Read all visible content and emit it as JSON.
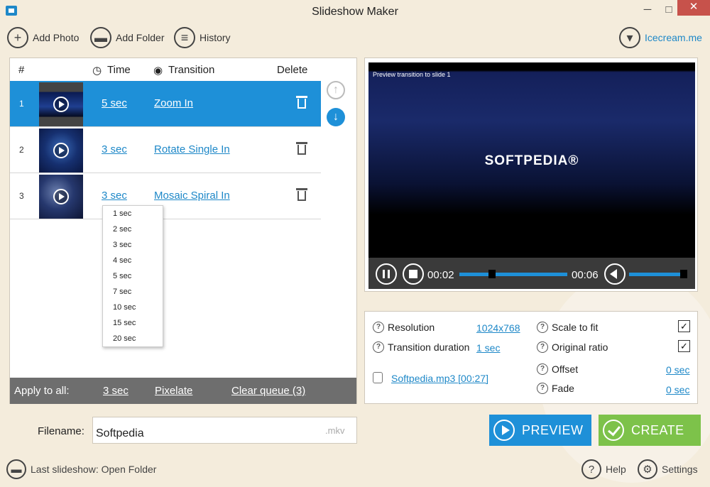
{
  "window": {
    "title": "Slideshow Maker",
    "minimize": "─",
    "maximize": "□",
    "close": "✕"
  },
  "toolbar": {
    "add_photo": "Add Photo",
    "add_folder": "Add Folder",
    "history": "History",
    "icecream": "Icecream.me"
  },
  "queue": {
    "headers": {
      "num": "#",
      "time": "Time",
      "transition": "Transition",
      "delete": "Delete"
    },
    "rows": [
      {
        "num": "1",
        "time": "5 sec",
        "transition": "Zoom In",
        "selected": true
      },
      {
        "num": "2",
        "time": "3 sec",
        "transition": "Rotate Single In",
        "selected": false
      },
      {
        "num": "3",
        "time": "3 sec",
        "transition": "Mosaic Spiral In",
        "selected": false
      }
    ],
    "time_dropdown": [
      "1 sec",
      "2 sec",
      "3 sec",
      "4 sec",
      "5 sec",
      "7 sec",
      "10 sec",
      "15 sec",
      "20 sec"
    ],
    "apply_all": {
      "label": "Apply to all:",
      "time": "3 sec",
      "transition": "Pixelate",
      "clear": "Clear queue (3)"
    }
  },
  "player": {
    "caption": "Preview transition to slide 1",
    "logo": "SOFTPEDIA®",
    "current_time": "00:02",
    "total_time": "00:06",
    "progress": 0.3,
    "volume": 1.0
  },
  "settings": {
    "resolution_label": "Resolution",
    "resolution_value": "1024x768",
    "transition_duration_label": "Transition duration",
    "transition_duration_value": "1 sec",
    "audio_file": "Softpedia.mp3 [00:27]",
    "scale_to_fit_label": "Scale to fit",
    "scale_to_fit": true,
    "original_ratio_label": "Original ratio",
    "original_ratio": true,
    "offset_label": "Offset",
    "offset_value": "0 sec",
    "fade_label": "Fade",
    "fade_value": "0 sec"
  },
  "output": {
    "filename_label": "Filename:",
    "filename": "Softpedia",
    "extension": ".mkv",
    "preview_button": "PREVIEW",
    "create_button": "CREATE"
  },
  "footer": {
    "last_slideshow": "Last slideshow: Open Folder",
    "help": "Help",
    "settings": "Settings"
  },
  "colors": {
    "accent": "#1e90d8",
    "create": "#7dc24a",
    "background": "#f4ecdc"
  }
}
